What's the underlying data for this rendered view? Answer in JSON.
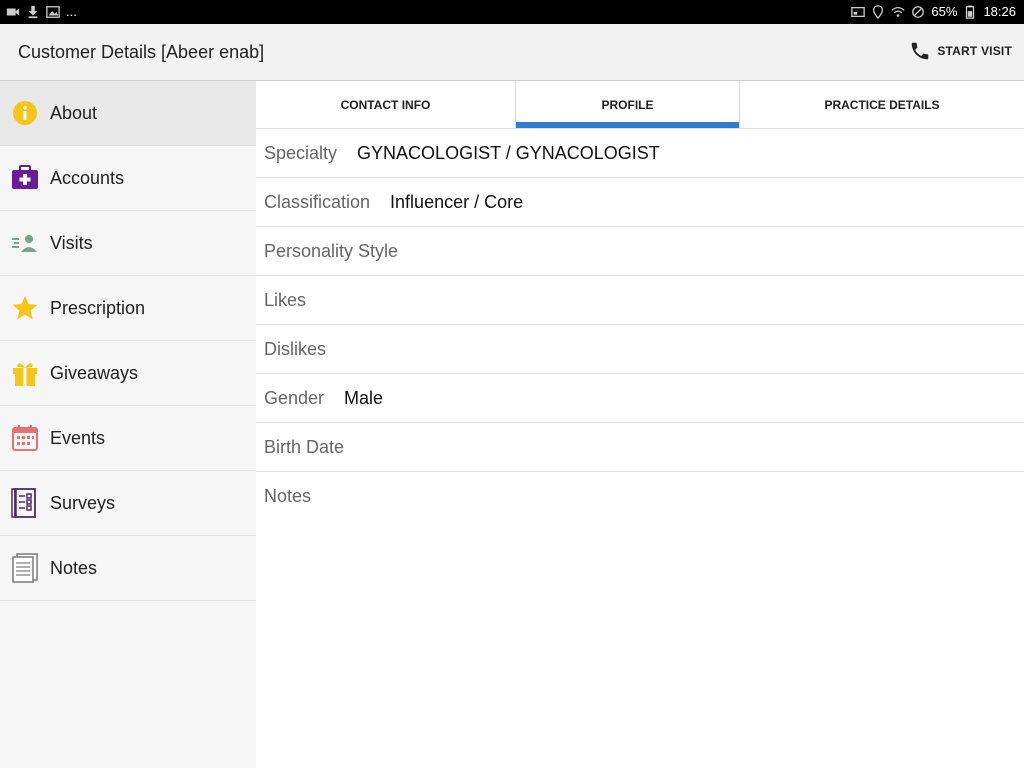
{
  "status_bar": {
    "left_ellipsis": "...",
    "battery": "65%",
    "time": "18:26"
  },
  "app_bar": {
    "title": "Customer Details [Abeer enab]",
    "action_label": "START VISIT"
  },
  "sidebar": {
    "items": [
      {
        "label": "About",
        "icon": "info-icon"
      },
      {
        "label": "Accounts",
        "icon": "medical-bag-icon"
      },
      {
        "label": "Visits",
        "icon": "visits-icon"
      },
      {
        "label": "Prescription",
        "icon": "star-icon"
      },
      {
        "label": "Giveaways",
        "icon": "gift-icon"
      },
      {
        "label": "Events",
        "icon": "calendar-icon"
      },
      {
        "label": "Surveys",
        "icon": "survey-icon"
      },
      {
        "label": "Notes",
        "icon": "notes-icon"
      }
    ],
    "active_index": 0
  },
  "tabs": [
    {
      "label": "CONTACT INFO"
    },
    {
      "label": "PROFILE"
    },
    {
      "label": "PRACTICE DETAILS"
    }
  ],
  "active_tab": "PROFILE",
  "profile": {
    "rows": [
      {
        "label": "Specialty",
        "value": "GYNACOLOGIST / GYNACOLOGIST"
      },
      {
        "label": "Classification",
        "value": "Influencer / Core"
      },
      {
        "label": "Personality Style",
        "value": ""
      },
      {
        "label": "Likes",
        "value": ""
      },
      {
        "label": "Dislikes",
        "value": ""
      },
      {
        "label": "Gender",
        "value": "Male"
      },
      {
        "label": "Birth Date",
        "value": ""
      },
      {
        "label": "Notes",
        "value": ""
      }
    ]
  },
  "colors": {
    "accent": "#2f7cd3",
    "info_yellow": "#f5c518",
    "accounts_purple": "#6a1b9a",
    "events_red": "#e57373"
  }
}
